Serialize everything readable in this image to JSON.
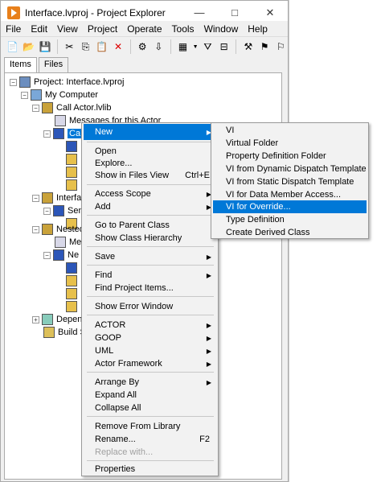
{
  "window": {
    "title": "Interface.lvproj - Project Explorer",
    "buttons": [
      "—",
      "□",
      "✕"
    ]
  },
  "menubar": [
    "File",
    "Edit",
    "View",
    "Project",
    "Operate",
    "Tools",
    "Window",
    "Help"
  ],
  "tabs": [
    "Items",
    "Files"
  ],
  "tree": [
    {
      "label": "Project: Interface.lvproj",
      "icon": "project-icon"
    },
    {
      "label": "My Computer",
      "icon": "computer-icon"
    },
    {
      "label": "Call Actor.lvlib",
      "icon": "library-icon"
    },
    {
      "label": "Messages for this Actor",
      "icon": "message-folder-icon"
    },
    {
      "label": "Ca",
      "icon": "class-icon"
    },
    {
      "label": "Interfa",
      "icon": "class-icon"
    },
    {
      "label": "Sen",
      "icon": "class-icon"
    },
    {
      "label": "Nested",
      "icon": "library-icon"
    },
    {
      "label": "Me",
      "icon": "message-folder-icon"
    },
    {
      "label": "Ne",
      "icon": "class-icon"
    },
    {
      "label": "Depen",
      "icon": "dependencies-icon"
    },
    {
      "label": "Build S",
      "icon": "build-spec-icon"
    }
  ],
  "context_menu": {
    "items": [
      {
        "label": "New",
        "submenu": true,
        "highlighted": true
      },
      {
        "label": "Open"
      },
      {
        "label": "Explore..."
      },
      {
        "label": "Show in Files View",
        "shortcut": "Ctrl+E"
      },
      {
        "label": "Access Scope",
        "submenu": true
      },
      {
        "label": "Add",
        "submenu": true
      },
      {
        "label": "Go to Parent Class"
      },
      {
        "label": "Show Class Hierarchy"
      },
      {
        "label": "Save",
        "submenu": true
      },
      {
        "label": "Find",
        "submenu": true
      },
      {
        "label": "Find Project Items..."
      },
      {
        "label": "Show Error Window"
      },
      {
        "label": "ACTOR",
        "submenu": true
      },
      {
        "label": "GOOP",
        "submenu": true
      },
      {
        "label": "UML",
        "submenu": true
      },
      {
        "label": "Actor Framework",
        "submenu": true
      },
      {
        "label": "Arrange By",
        "submenu": true
      },
      {
        "label": "Expand All"
      },
      {
        "label": "Collapse All"
      },
      {
        "label": "Remove From Library"
      },
      {
        "label": "Rename...",
        "shortcut": "F2"
      },
      {
        "label": "Replace with...",
        "disabled": true
      },
      {
        "label": "Properties"
      }
    ]
  },
  "submenu_new": {
    "items": [
      {
        "label": "VI"
      },
      {
        "label": "Virtual Folder"
      },
      {
        "label": "Property Definition Folder"
      },
      {
        "label": "VI from Dynamic Dispatch Template"
      },
      {
        "label": "VI from Static Dispatch Template"
      },
      {
        "label": "VI for Data Member Access..."
      },
      {
        "label": "VI for Override...",
        "highlighted": true
      },
      {
        "label": "Type Definition"
      },
      {
        "label": "Create Derived Class"
      }
    ]
  }
}
